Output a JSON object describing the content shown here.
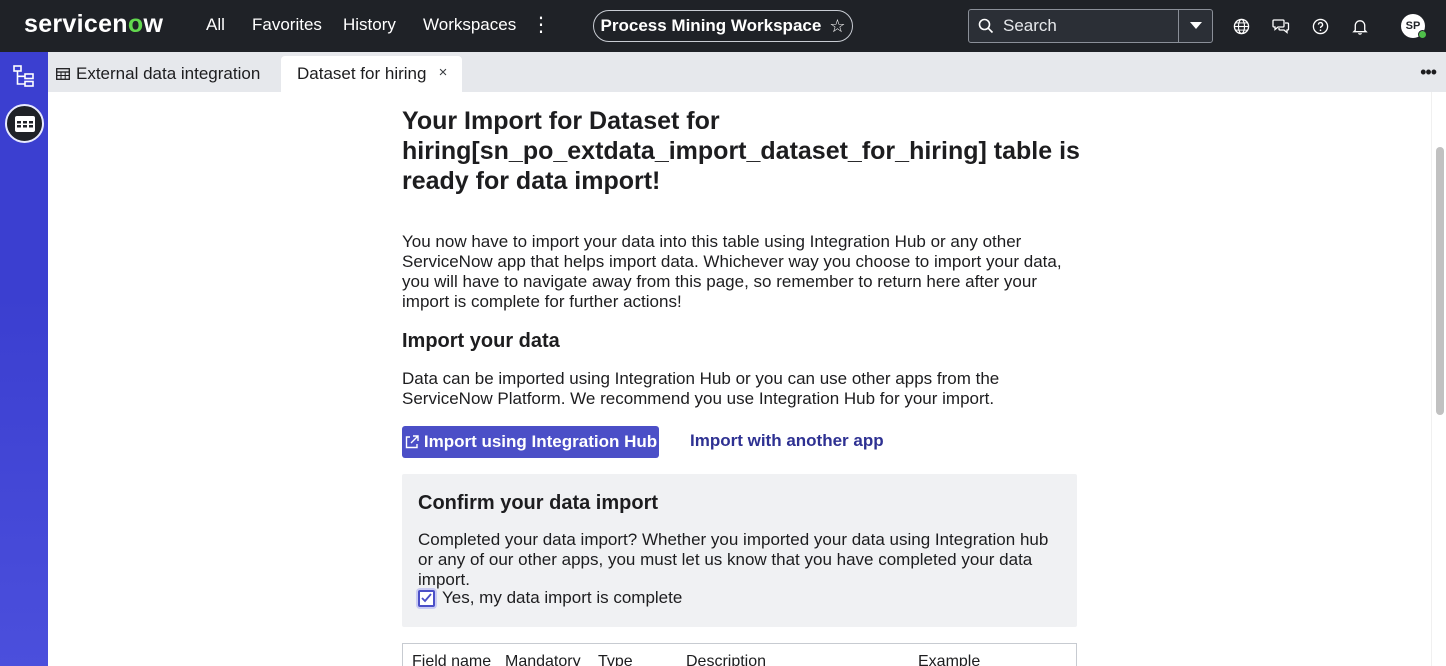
{
  "topbar": {
    "logo": "servicenow",
    "nav": [
      "All",
      "Favorites",
      "History",
      "Workspaces"
    ],
    "workspace_title": "Process Mining Workspace",
    "search_placeholder": "Search",
    "avatar_initials": "SP"
  },
  "tabs": [
    {
      "label": "External data integration",
      "icon": "table-icon",
      "active": false
    },
    {
      "label": "Dataset for hiring",
      "active": true,
      "close": "×"
    }
  ],
  "main": {
    "title": "Your Import for Dataset for hiring[sn_po_extdata_import_dataset_for_hiring] table is ready for data import!",
    "intro": "You now have to import your data into this table using Integration Hub or any other ServiceNow app that helps import data. Whichever way you choose to import your data, you will have to navigate away from this page, so remember to return here after your import is complete for further actions!",
    "import_heading": "Import your data",
    "import_text": "Data can be imported using Integration Hub or you can use other apps from the ServiceNow Platform. We recommend you use Integration Hub for your import.",
    "primary_button": "Import using Integration Hub",
    "secondary_link": "Import with another app",
    "confirm": {
      "heading": "Confirm your data import",
      "text": "Completed your data import? Whether you imported your data using Integration hub or any of our other apps, you must let us know that you have completed your data import.",
      "checkbox_label": "Yes, my data import is complete",
      "checked": true
    },
    "table_headers": [
      "Field name",
      "Mandatory",
      "Type",
      "Description",
      "Example"
    ]
  },
  "colors": {
    "topbar": "#1f2227",
    "rail": "#3b3fd0",
    "primary": "#4b4fc7",
    "link": "#2e3192",
    "logo_accent": "#62d84e"
  }
}
